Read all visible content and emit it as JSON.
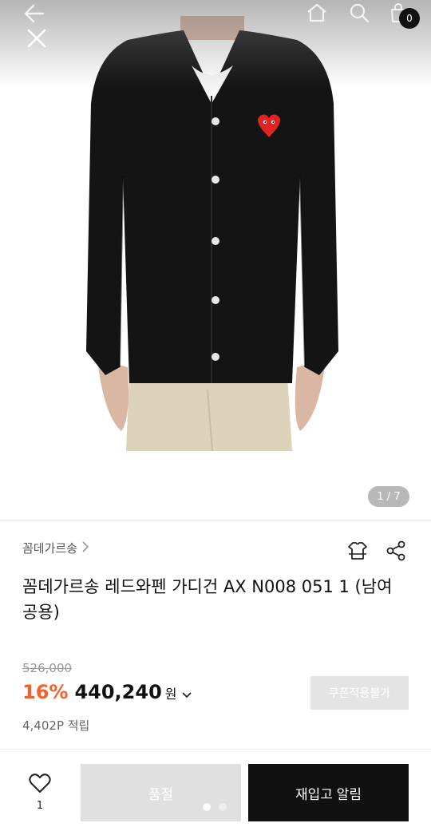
{
  "header": {
    "cart_count": "0",
    "icons": [
      "back-arrow-icon",
      "home-icon",
      "search-icon",
      "cart-icon",
      "close-icon"
    ]
  },
  "gallery": {
    "pager": "1 / 7"
  },
  "product": {
    "brand": "꼼데가르송",
    "title": "꼼데가르송 레드와펜 가디건 AX N008 051 1 (남여공용)",
    "original_price": "526,000",
    "discount": "16%",
    "price": "440,240",
    "currency": "원",
    "points": "4,402P 적립"
  },
  "buttons": {
    "coupon": "쿠폰적용불가",
    "soldout": "품절",
    "restock": "재입고 알림"
  },
  "wishlist": {
    "count": "1"
  },
  "colors": {
    "discount": "#f2622e",
    "primary_button": "#111111",
    "disabled_button": "#e0e0e0"
  }
}
